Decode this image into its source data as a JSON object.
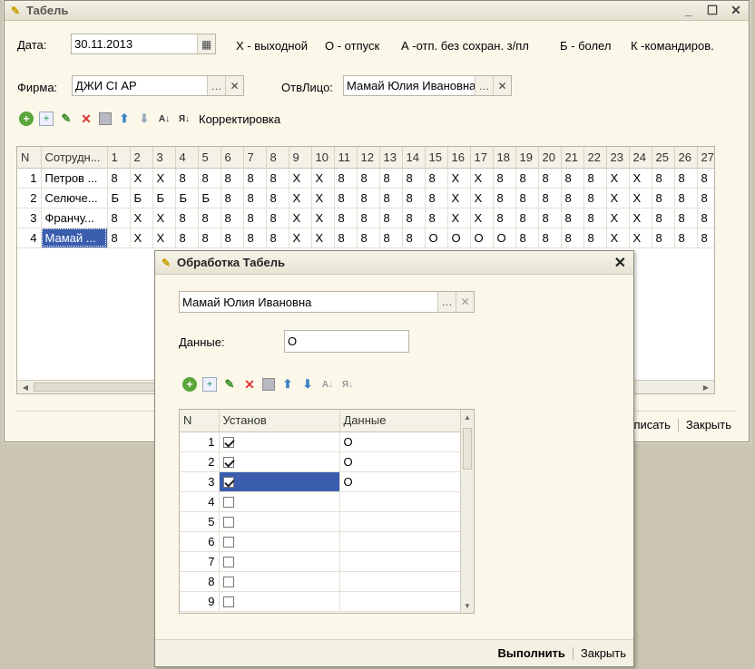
{
  "main": {
    "title": "Табель",
    "date_label": "Дата:",
    "date_value": "30.11.2013",
    "legend": [
      "Х - выходной",
      "О - отпуск",
      "А -отп. без сохран. з/пл",
      "Б - болел",
      "К -командиров."
    ],
    "firm_label": "Фирма:",
    "firm_value": "ДЖИ СІ АР",
    "resp_label": "ОтвЛицо:",
    "resp_value": "Мамай Юлия Ивановна",
    "correction_label": "Корректировка",
    "columns": [
      "N",
      "Сотрудн...",
      "1",
      "2",
      "3",
      "4",
      "5",
      "6",
      "7",
      "8",
      "9",
      "10",
      "11",
      "12",
      "13",
      "14",
      "15",
      "16",
      "17",
      "18",
      "19",
      "20",
      "21",
      "22",
      "23",
      "24",
      "25",
      "26",
      "27"
    ],
    "rows": [
      {
        "n": "1",
        "name": "Петров ...",
        "days": [
          "8",
          "Х",
          "Х",
          "8",
          "8",
          "8",
          "8",
          "8",
          "Х",
          "Х",
          "8",
          "8",
          "8",
          "8",
          "8",
          "Х",
          "Х",
          "8",
          "8",
          "8",
          "8",
          "8",
          "Х",
          "Х",
          "8",
          "8",
          "8"
        ]
      },
      {
        "n": "2",
        "name": "Селюче...",
        "days": [
          "Б",
          "Б",
          "Б",
          "Б",
          "Б",
          "8",
          "8",
          "8",
          "Х",
          "Х",
          "8",
          "8",
          "8",
          "8",
          "8",
          "Х",
          "Х",
          "8",
          "8",
          "8",
          "8",
          "8",
          "Х",
          "Х",
          "8",
          "8",
          "8"
        ]
      },
      {
        "n": "3",
        "name": "Франчу...",
        "days": [
          "8",
          "Х",
          "Х",
          "8",
          "8",
          "8",
          "8",
          "8",
          "Х",
          "Х",
          "8",
          "8",
          "8",
          "8",
          "8",
          "Х",
          "Х",
          "8",
          "8",
          "8",
          "8",
          "8",
          "Х",
          "Х",
          "8",
          "8",
          "8"
        ]
      },
      {
        "n": "4",
        "name": "Мамай ...",
        "days": [
          "8",
          "Х",
          "Х",
          "8",
          "8",
          "8",
          "8",
          "8",
          "Х",
          "Х",
          "8",
          "8",
          "8",
          "8",
          "О",
          "О",
          "О",
          "О",
          "8",
          "8",
          "8",
          "8",
          "Х",
          "Х",
          "8",
          "8",
          "8"
        ]
      }
    ],
    "footer_write": "писать",
    "footer_close": "Закрыть"
  },
  "dialog": {
    "title": "Обработка  Табель",
    "employee_value": "Мамай Юлия Ивановна",
    "data_label": "Данные:",
    "data_value": "О",
    "columns": [
      "N",
      "Установ",
      "Данные"
    ],
    "rows": [
      {
        "n": "1",
        "checked": true,
        "data": "О"
      },
      {
        "n": "2",
        "checked": true,
        "data": "О"
      },
      {
        "n": "3",
        "checked": true,
        "data": "О"
      },
      {
        "n": "4",
        "checked": false,
        "data": ""
      },
      {
        "n": "5",
        "checked": false,
        "data": ""
      },
      {
        "n": "6",
        "checked": false,
        "data": ""
      },
      {
        "n": "7",
        "checked": false,
        "data": ""
      },
      {
        "n": "8",
        "checked": false,
        "data": ""
      },
      {
        "n": "9",
        "checked": false,
        "data": ""
      }
    ],
    "run_label": "Выполнить",
    "close_label": "Закрыть"
  }
}
